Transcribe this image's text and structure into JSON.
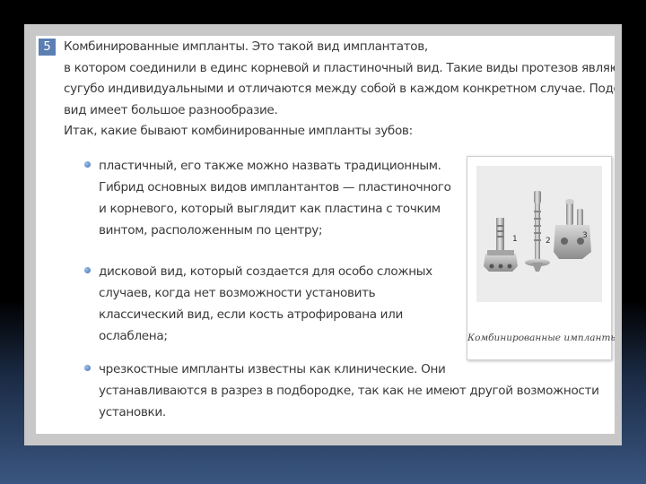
{
  "slide": {
    "number": "5",
    "intro_lines": [
      "Комбинированные импланты. Это такой вид имплантатов,",
      "в котором соединили в единс корневой и пластиночный вид. Такие виды протезов являются",
      "сугубо индивидуальными и отличаются между собой в каждом конкретном случае. Подобный",
      "вид имеет большое разнообразие.",
      "Итак, какие бывают комбинированные импланты зубов:"
    ],
    "bullets": [
      {
        "lines": [
          "пластичный, его также можно назвать традиционным.",
          "Гибрид основных видов имплантантов — пластиночного",
          "и корневого, который выглядит как пластина с точким",
          "винтом, расположенным по центру;"
        ]
      },
      {
        "lines": [
          "дисковой вид, который создается для особо сложных",
          "случаев, когда нет возможности установить",
          "классический вид, если кость атрофирована или",
          "ослаблена;"
        ]
      },
      {
        "lines": [
          "чрезкостные импланты известны как клинические. Они",
          "устанавливаются в разрез в подбородке, так как не имеют другой возможности",
          "установки."
        ]
      }
    ],
    "figure": {
      "labels": [
        "1",
        "2",
        "3"
      ],
      "caption": "Комбинированные импланты"
    }
  },
  "colors": {
    "badge": "#5b7fb3",
    "text": "#3a3a3a",
    "frame": "#c8c8c8"
  }
}
